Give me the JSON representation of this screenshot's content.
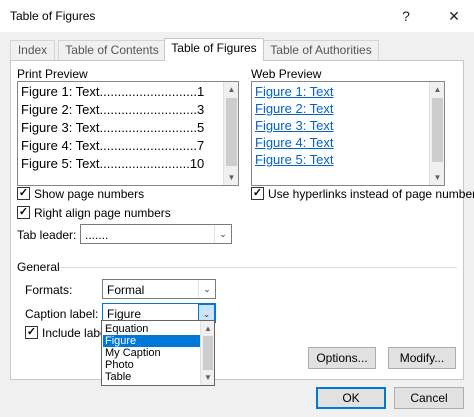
{
  "window": {
    "title": "Table of Figures",
    "help": "?",
    "close": "✕"
  },
  "tabs": [
    "Index",
    "Table of Contents",
    "Table of Figures",
    "Table of Authorities"
  ],
  "print_preview": {
    "label": "Print Preview",
    "lines": [
      "Figure 1: Text...........................1",
      "Figure 2: Text...........................3",
      "Figure 3: Text...........................5",
      "Figure 4: Text...........................7",
      "Figure 5: Text.........................10"
    ]
  },
  "web_preview": {
    "label": "Web Preview",
    "lines": [
      "Figure 1: Text",
      "Figure 2: Text",
      "Figure 3: Text",
      "Figure 4: Text",
      "Figure 5: Text"
    ]
  },
  "options": {
    "show_page_numbers": {
      "label": "Show page numbers",
      "checked": true
    },
    "right_align": {
      "label": "Right align page numbers",
      "checked": true
    },
    "use_hyperlinks": {
      "label": "Use hyperlinks instead of page numbers",
      "checked": true
    },
    "tab_leader": {
      "label": "Tab leader:",
      "value": "......."
    }
  },
  "general": {
    "label": "General",
    "formats": {
      "label": "Formats:",
      "value": "Formal"
    },
    "caption_label": {
      "label": "Caption label:",
      "value": "Figure"
    },
    "include_label": {
      "label": "Include labe",
      "checked": true
    },
    "dropdown_items": [
      "Equation",
      "Figure",
      "My Caption",
      "Photo",
      "Table"
    ]
  },
  "buttons": {
    "options": "Options...",
    "modify": "Modify...",
    "ok": "OK",
    "cancel": "Cancel"
  },
  "check_glyph": "✓",
  "arrow_up": "▲",
  "arrow_down": "▼",
  "chevron": "⌄"
}
